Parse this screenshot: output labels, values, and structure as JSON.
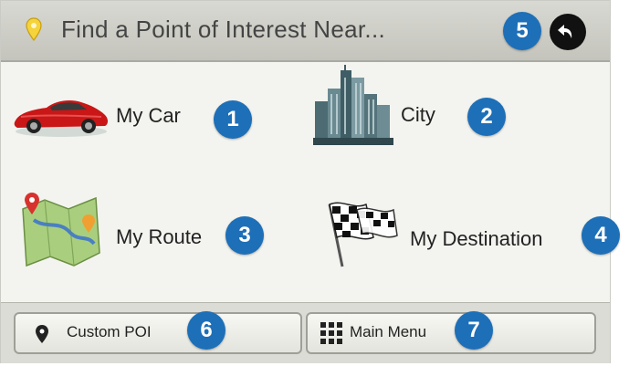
{
  "header": {
    "title": "Find a Point of Interest Near...",
    "pin_icon": "map-pin-icon",
    "back_icon": "back-arrow-icon"
  },
  "callouts": {
    "my_car": "1",
    "city": "2",
    "my_route": "3",
    "my_destination": "4",
    "back": "5",
    "custom_poi": "6",
    "main_menu": "7"
  },
  "options": {
    "my_car": {
      "label": "My Car",
      "icon": "car-icon"
    },
    "city": {
      "label": "City",
      "icon": "city-skyline-icon"
    },
    "my_route": {
      "label": "My Route",
      "icon": "route-map-icon"
    },
    "my_destination": {
      "label": "My Destination",
      "icon": "checkered-flag-icon"
    }
  },
  "footer": {
    "custom_poi": {
      "label": "Custom POI",
      "icon": "map-pin-icon"
    },
    "main_menu": {
      "label": "Main Menu",
      "icon": "grid-menu-icon"
    }
  },
  "colors": {
    "badge": "#1d6fb8",
    "header": "#cfcfc8",
    "background": "#f3f4ef"
  }
}
